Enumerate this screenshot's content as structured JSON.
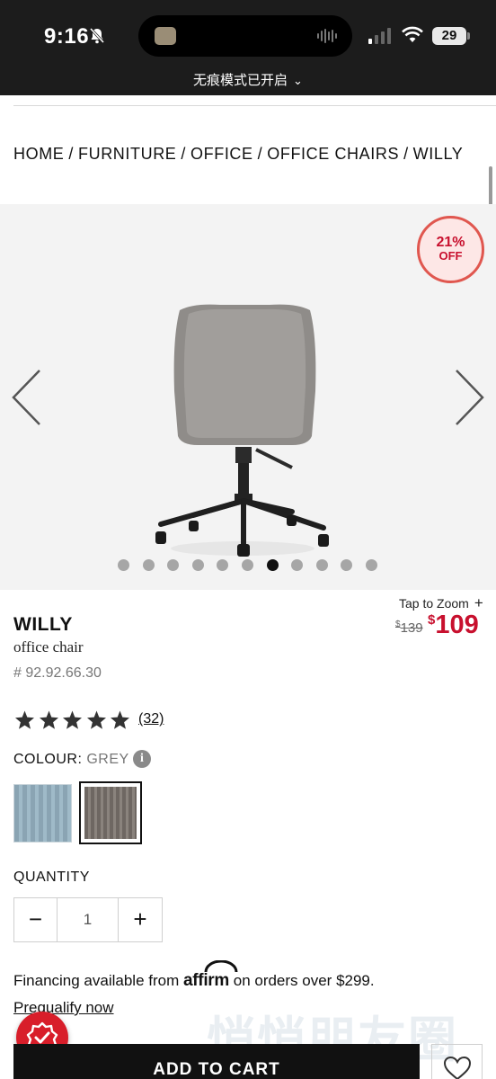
{
  "status_bar": {
    "time": "9:16",
    "battery": "29",
    "incognito_banner": "无痕模式已开启",
    "icons": [
      "bell-slash-icon",
      "signal-icon",
      "wifi-icon",
      "battery-icon"
    ]
  },
  "breadcrumb": [
    "HOME",
    "FURNITURE",
    "OFFICE",
    "OFFICE CHAIRS",
    "WILLY"
  ],
  "breadcrumb_separator": "/",
  "gallery": {
    "badge_percent": "21%",
    "badge_off": "OFF",
    "image_count": 11,
    "active_index": 6,
    "icons": [
      "chevron-left-icon",
      "chevron-right-icon"
    ]
  },
  "product": {
    "tap_to_zoom": "Tap to Zoom",
    "zoom_plus": "+",
    "name": "WILLY",
    "type": "office chair",
    "sku": "# 92.92.66.30",
    "old_price_currency": "$",
    "old_price": "139",
    "new_price_currency": "$",
    "new_price": "109",
    "rating_stars": 5,
    "reviews": "(32)"
  },
  "colour": {
    "label": "COLOUR:",
    "value": "GREY",
    "info": "i",
    "swatches": [
      {
        "name": "blue",
        "color": "#94afbe",
        "selected": false
      },
      {
        "name": "grey",
        "color": "#7b746e",
        "selected": true
      }
    ]
  },
  "quantity": {
    "label": "QUANTITY",
    "minus": "−",
    "value": "1",
    "plus": "+"
  },
  "financing": {
    "prefix": "Financing available from",
    "brand": "affirm",
    "suffix": "on orders over $299.",
    "link": "Prequalify now"
  },
  "watermark": "悄悄朋友圈",
  "actions": {
    "add_to_cart": "ADD TO CART"
  },
  "colors": {
    "accent": "#c8102e",
    "badge_border": "#e0574f",
    "button": "#111111"
  }
}
